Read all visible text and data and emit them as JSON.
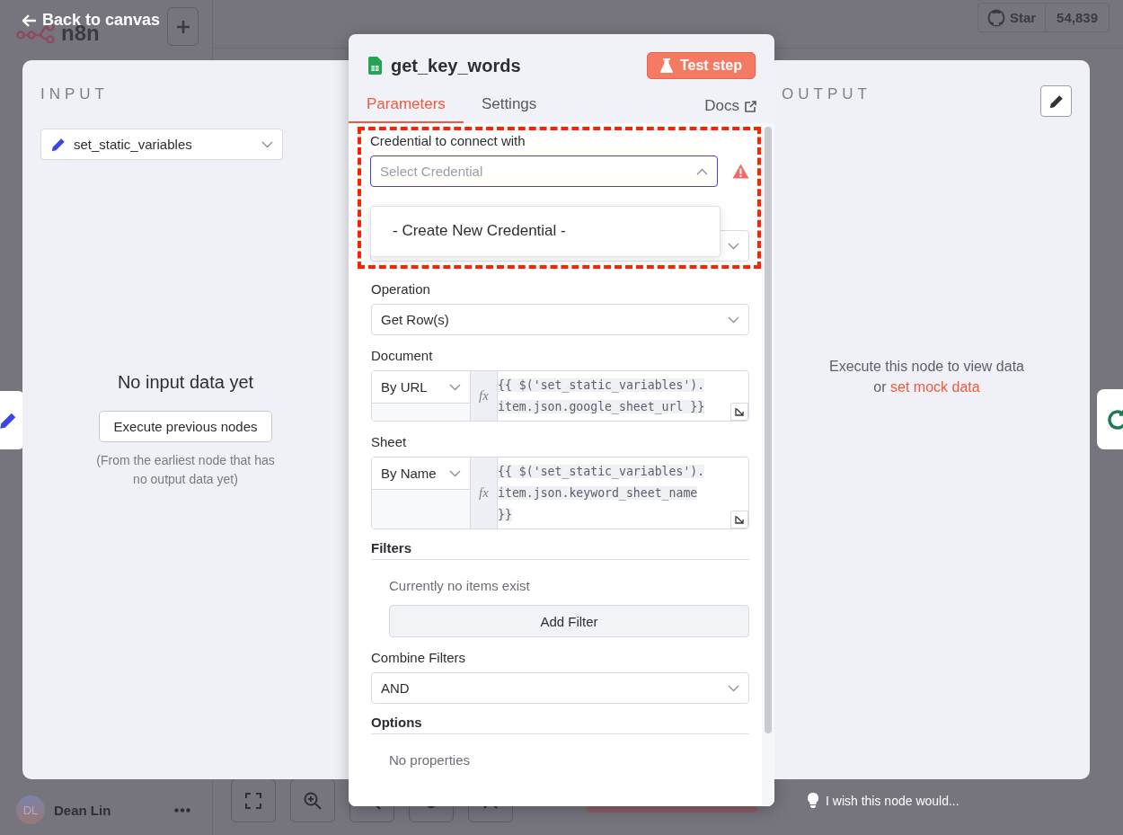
{
  "header": {
    "back_link": "Back to canvas",
    "logo_text": "n8n",
    "github": {
      "label": "Star",
      "count": "54,839"
    }
  },
  "user": {
    "initials": "DL",
    "name": "Dean Lin"
  },
  "hint": "I wish this node would...",
  "input_panel": {
    "title": "INPUT",
    "node_select": "set_static_variables",
    "empty_title": "No input data yet",
    "button": "Execute previous nodes",
    "note": "(From the earliest node that has no output data yet)"
  },
  "node_panel": {
    "title": "get_key_words",
    "test_button": "Test step",
    "tabs": [
      {
        "label": "Parameters",
        "selected": true
      },
      {
        "label": "Settings",
        "selected": false
      }
    ],
    "docs_link": "Docs",
    "fields": [
      {
        "kind": "credential",
        "label": "Credential to connect with",
        "placeholder": "Select Credential",
        "open": true,
        "warning": true,
        "option": "- Create New Credential -"
      },
      {
        "kind": "select",
        "label": "Operation",
        "value": "Get Row(s)"
      },
      {
        "kind": "locator",
        "label": "Document",
        "mode": "By URL",
        "badge": "fx",
        "expression": [
          "{{ $('set_static_variables').",
          "item.json.google_sheet_url }}"
        ]
      },
      {
        "kind": "locator",
        "label": "Sheet",
        "mode": "By Name",
        "badge": "fx",
        "expression": [
          "{{ $('set_static_variables').",
          "item.json.keyword_sheet_name",
          "}}"
        ]
      },
      {
        "kind": "collection",
        "label": "Filters",
        "empty": "Currently no items exist",
        "button": "Add Filter"
      },
      {
        "kind": "select",
        "label": "Combine Filters",
        "value": "AND"
      },
      {
        "kind": "collection",
        "label": "Options",
        "empty": "No properties"
      }
    ]
  },
  "output_panel": {
    "title": "OUTPUT",
    "message": "Execute this node to view data",
    "mock_prefix": "or",
    "mock_link": "set mock data"
  }
}
